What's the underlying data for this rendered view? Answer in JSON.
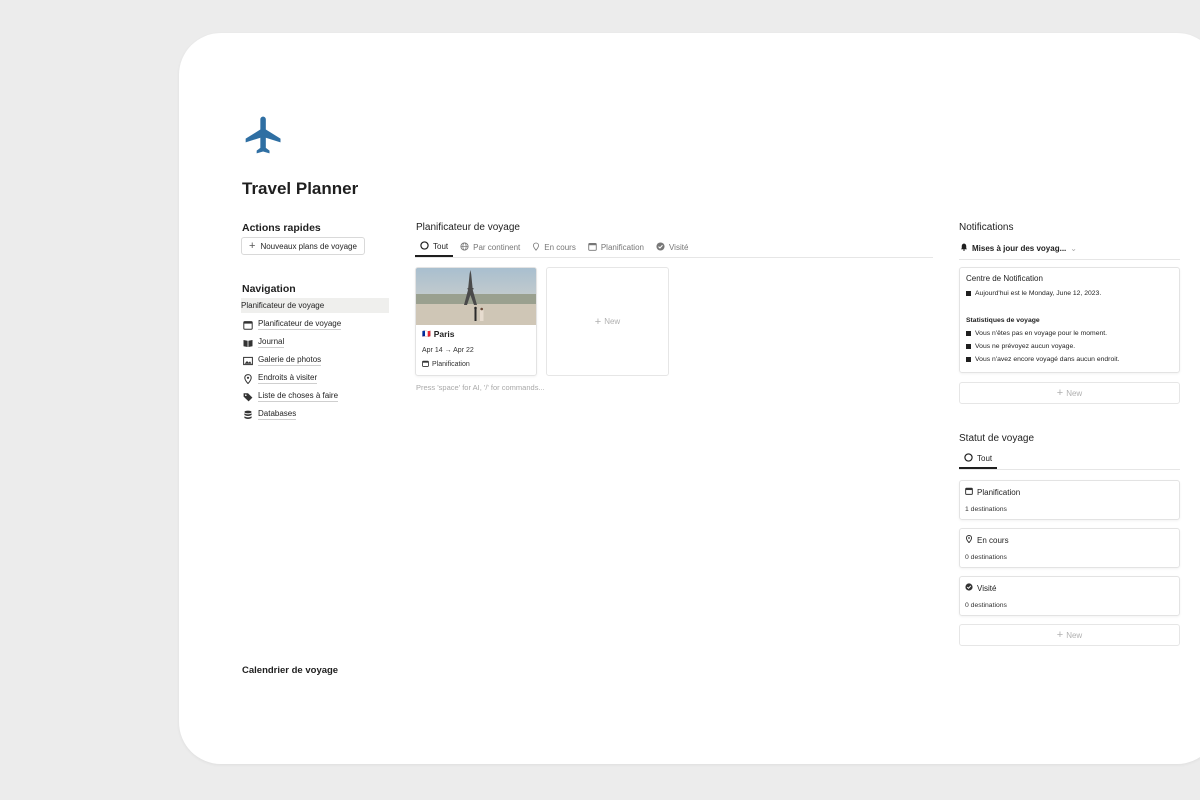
{
  "page": {
    "title": "Travel Planner",
    "icon": "airplane-icon",
    "accent_color": "#2f6fa3"
  },
  "quick_actions": {
    "heading": "Actions rapides",
    "new_plan_label": "Nouveaux plans de voyage"
  },
  "navigation": {
    "heading": "Navigation",
    "items": [
      {
        "label": "Planificateur de voyage",
        "icon": "none"
      },
      {
        "label": "Planificateur de voyage",
        "icon": "calendar-icon"
      },
      {
        "label": "Journal",
        "icon": "book-icon"
      },
      {
        "label": "Galerie de photos",
        "icon": "image-icon"
      },
      {
        "label": "Endroits à visiter",
        "icon": "location-pin-icon"
      },
      {
        "label": "Liste de choses à faire",
        "icon": "tag-icon"
      },
      {
        "label": "Databases",
        "icon": "database-icon"
      }
    ]
  },
  "planner": {
    "heading": "Planificateur de voyage",
    "tabs": [
      {
        "label": "Tout",
        "icon": "circle-icon"
      },
      {
        "label": "Par continent",
        "icon": "globe-icon"
      },
      {
        "label": "En cours",
        "icon": "location-pin-icon"
      },
      {
        "label": "Planification",
        "icon": "calendar-icon"
      },
      {
        "label": "Visité",
        "icon": "check-circle-icon"
      }
    ],
    "card": {
      "flag": "🇫🇷",
      "title": "Paris",
      "dates": "Apr 14 → Apr 22",
      "status": "Planification"
    },
    "new_label": "New",
    "hint": "Press 'space' for AI, '/' for commands..."
  },
  "notifications": {
    "heading": "Notifications",
    "view_label": "Mises à jour des voyag...",
    "box": {
      "title": "Centre de Notification",
      "today": "Aujourd'hui est le Monday, June 12, 2023.",
      "stats_heading": "Statistiques de voyage",
      "stats": [
        "Vous n'êtes pas en voyage pour le moment.",
        "Vous ne prévoyez aucun voyage.",
        "Vous n'avez encore voyagé dans aucun endroit."
      ]
    },
    "new_label": "New"
  },
  "status": {
    "heading": "Statut de voyage",
    "tab": "Tout",
    "cards": [
      {
        "label": "Planification",
        "count": "1 destinations",
        "icon": "calendar-icon"
      },
      {
        "label": "En cours",
        "count": "0 destinations",
        "icon": "location-pin-icon"
      },
      {
        "label": "Visité",
        "count": "0 destinations",
        "icon": "check-circle-icon"
      }
    ],
    "new_label": "New"
  },
  "calendar": {
    "heading": "Calendrier de voyage"
  }
}
